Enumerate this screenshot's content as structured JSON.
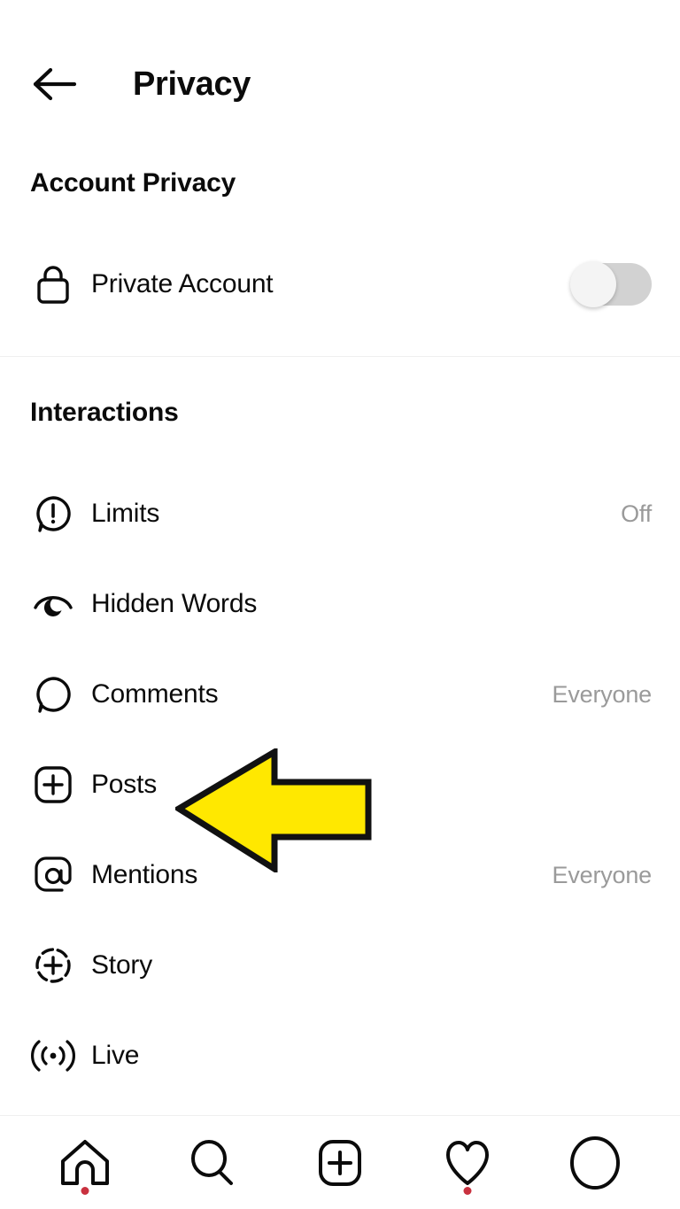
{
  "header": {
    "title": "Privacy",
    "back_icon": "arrow-left-icon"
  },
  "sections": [
    {
      "id": "account-privacy",
      "title": "Account Privacy",
      "rows": [
        {
          "id": "private-account",
          "icon": "lock-icon",
          "label": "Private Account",
          "control": "toggle",
          "toggle_on": false
        }
      ]
    },
    {
      "id": "interactions",
      "title": "Interactions",
      "rows": [
        {
          "id": "limits",
          "icon": "limits-icon",
          "label": "Limits",
          "value": "Off"
        },
        {
          "id": "hidden-words",
          "icon": "hidden-words-icon",
          "label": "Hidden Words",
          "value": ""
        },
        {
          "id": "comments",
          "icon": "comment-icon",
          "label": "Comments",
          "value": "Everyone"
        },
        {
          "id": "posts",
          "icon": "plus-square-icon",
          "label": "Posts",
          "value": ""
        },
        {
          "id": "mentions",
          "icon": "mention-icon",
          "label": "Mentions",
          "value": "Everyone"
        },
        {
          "id": "story",
          "icon": "story-icon",
          "label": "Story",
          "value": ""
        },
        {
          "id": "live",
          "icon": "live-icon",
          "label": "Live",
          "value": ""
        }
      ]
    }
  ],
  "annotation": {
    "type": "arrow",
    "direction": "left",
    "points_at": "Posts",
    "fill_color": "#FFE800",
    "stroke_color": "#111111"
  },
  "bottom_nav": {
    "items": [
      {
        "id": "home",
        "icon": "home-icon",
        "badge": true
      },
      {
        "id": "search",
        "icon": "search-icon",
        "badge": false
      },
      {
        "id": "create",
        "icon": "plus-square-icon",
        "badge": false
      },
      {
        "id": "activity",
        "icon": "heart-icon",
        "badge": true
      },
      {
        "id": "profile",
        "icon": "profile-circle-icon",
        "badge": false
      }
    ],
    "badge_color": "#c9313f"
  }
}
